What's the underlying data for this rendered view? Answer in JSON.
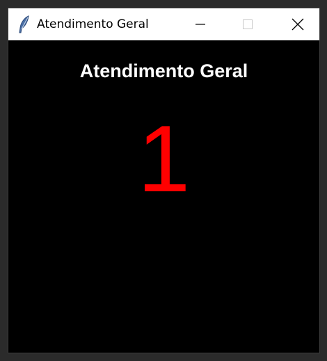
{
  "window": {
    "title": "Atendimento Geral",
    "icon": "feather-icon",
    "controls": {
      "minimize": "minimize-icon",
      "maximize": "maximize-icon",
      "close": "close-icon"
    }
  },
  "main": {
    "heading": "Atendimento Geral",
    "current_number": "1",
    "number_color": "#ff0000",
    "background_color": "#000000"
  }
}
